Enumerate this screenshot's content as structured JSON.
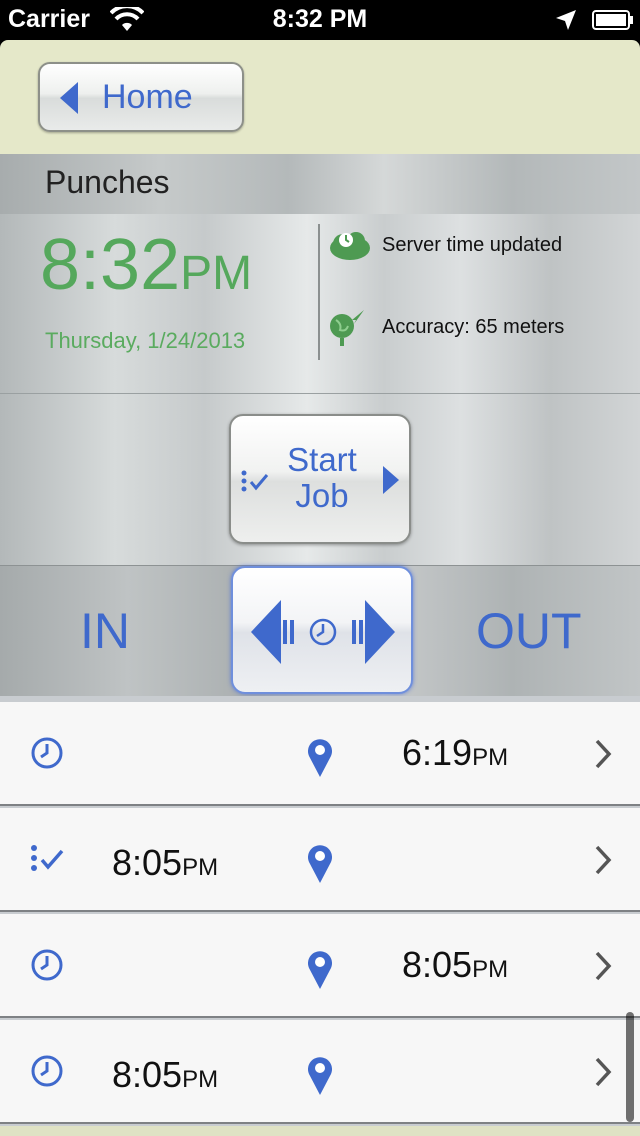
{
  "status_bar": {
    "carrier": "Carrier",
    "time": "8:32 PM"
  },
  "nav": {
    "home_label": "Home"
  },
  "section": {
    "title": "Punches"
  },
  "clock": {
    "time": "8:32",
    "ampm": "PM",
    "date": "Thursday, 1/24/2013",
    "server_status": "Server time updated",
    "accuracy": "Accuracy: 65 meters"
  },
  "job": {
    "start_line1": "Start",
    "start_line2": "Job"
  },
  "punch": {
    "in_label": "IN",
    "out_label": "OUT"
  },
  "rows": [
    {
      "type": "clock",
      "in_time": "",
      "in_ampm": "",
      "out_time": "6:19",
      "out_ampm": "PM"
    },
    {
      "type": "job",
      "in_time": "8:05",
      "in_ampm": "PM",
      "out_time": "",
      "out_ampm": ""
    },
    {
      "type": "clock",
      "in_time": "",
      "in_ampm": "",
      "out_time": "8:05",
      "out_ampm": "PM"
    },
    {
      "type": "clock",
      "in_time": "8:05",
      "in_ampm": "PM",
      "out_time": "",
      "out_ampm": ""
    }
  ],
  "colors": {
    "accent_blue": "#3f69cc",
    "accent_green": "#55a85c",
    "nav_bg": "#e5e8c9"
  }
}
